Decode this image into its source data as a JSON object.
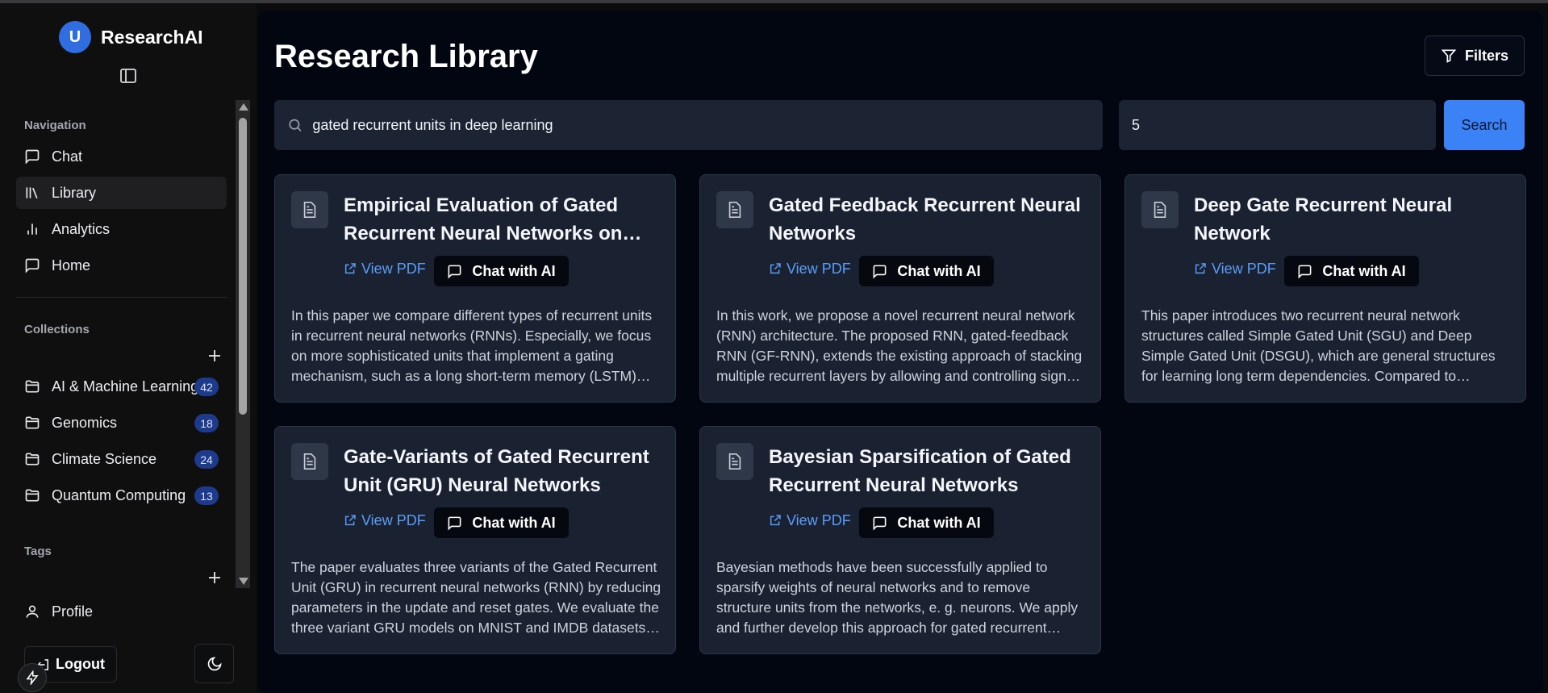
{
  "app": {
    "name": "ResearchAI",
    "avatar_letter": "U"
  },
  "sidebar": {
    "nav_label": "Navigation",
    "nav": [
      {
        "label": "Chat",
        "icon": "message-square-icon",
        "active": false
      },
      {
        "label": "Library",
        "icon": "library-icon",
        "active": true
      },
      {
        "label": "Analytics",
        "icon": "bar-chart-icon",
        "active": false
      },
      {
        "label": "Home",
        "icon": "message-square-icon",
        "active": false
      }
    ],
    "collections_label": "Collections",
    "collections": [
      {
        "label": "AI & Machine Learning",
        "count": "42"
      },
      {
        "label": "Genomics",
        "count": "18"
      },
      {
        "label": "Climate Science",
        "count": "24"
      },
      {
        "label": "Quantum Computing",
        "count": "13"
      }
    ],
    "tags_label": "Tags",
    "profile_label": "Profile",
    "logout_label": "Logout"
  },
  "main": {
    "title": "Research Library",
    "filters_label": "Filters",
    "search_value": "gated recurrent units in deep learning",
    "count_value": "5",
    "search_button": "Search",
    "view_pdf_label": "View PDF",
    "chat_label": "Chat with AI",
    "cards": [
      {
        "title": "Empirical Evaluation of Gated Recurrent Neural Networks on Sequence Modeling",
        "description": "In this paper we compare different types of recurrent units in recurrent neural networks (RNNs). Especially, we focus on more sophisticated units that implement a gating mechanism, such as a long short-term memory (LSTM) unit and a recently proposed gated recurrent unit (GRU)."
      },
      {
        "title": "Gated Feedback Recurrent Neural Networks",
        "description": "In this work, we propose a novel recurrent neural network (RNN) architecture. The proposed RNN, gated-feedback RNN (GF-RNN), extends the existing approach of stacking multiple recurrent layers by allowing and controlling signals flowing from upper recurrent layers to lower layers."
      },
      {
        "title": "Deep Gate Recurrent Neural Network",
        "description": "This paper introduces two recurrent neural network structures called Simple Gated Unit (SGU) and Deep Simple Gated Unit (DSGU), which are general structures for learning long term dependencies. Compared to traditional Long Short-Term Memory (LSTM) and Gated Recurrent Unit (GRU)."
      },
      {
        "title": "Gate-Variants of Gated Recurrent Unit (GRU) Neural Networks",
        "description": "The paper evaluates three variants of the Gated Recurrent Unit (GRU) in recurrent neural networks (RNN) by reducing parameters in the update and reset gates. We evaluate the three variant GRU models on MNIST and IMDB datasets and show that these GRU-RNN variant models perform as well as the original GRU RNN model."
      },
      {
        "title": "Bayesian Sparsification of Gated Recurrent Neural Networks",
        "description": "Bayesian methods have been successfully applied to sparsify weights of neural networks and to remove structure units from the networks, e. g. neurons. We apply and further develop this approach for gated recurrent architectures."
      }
    ]
  },
  "colors": {
    "accent": "#3b82f6",
    "link": "#5a9cf8",
    "badge": "#1e3a8a"
  }
}
